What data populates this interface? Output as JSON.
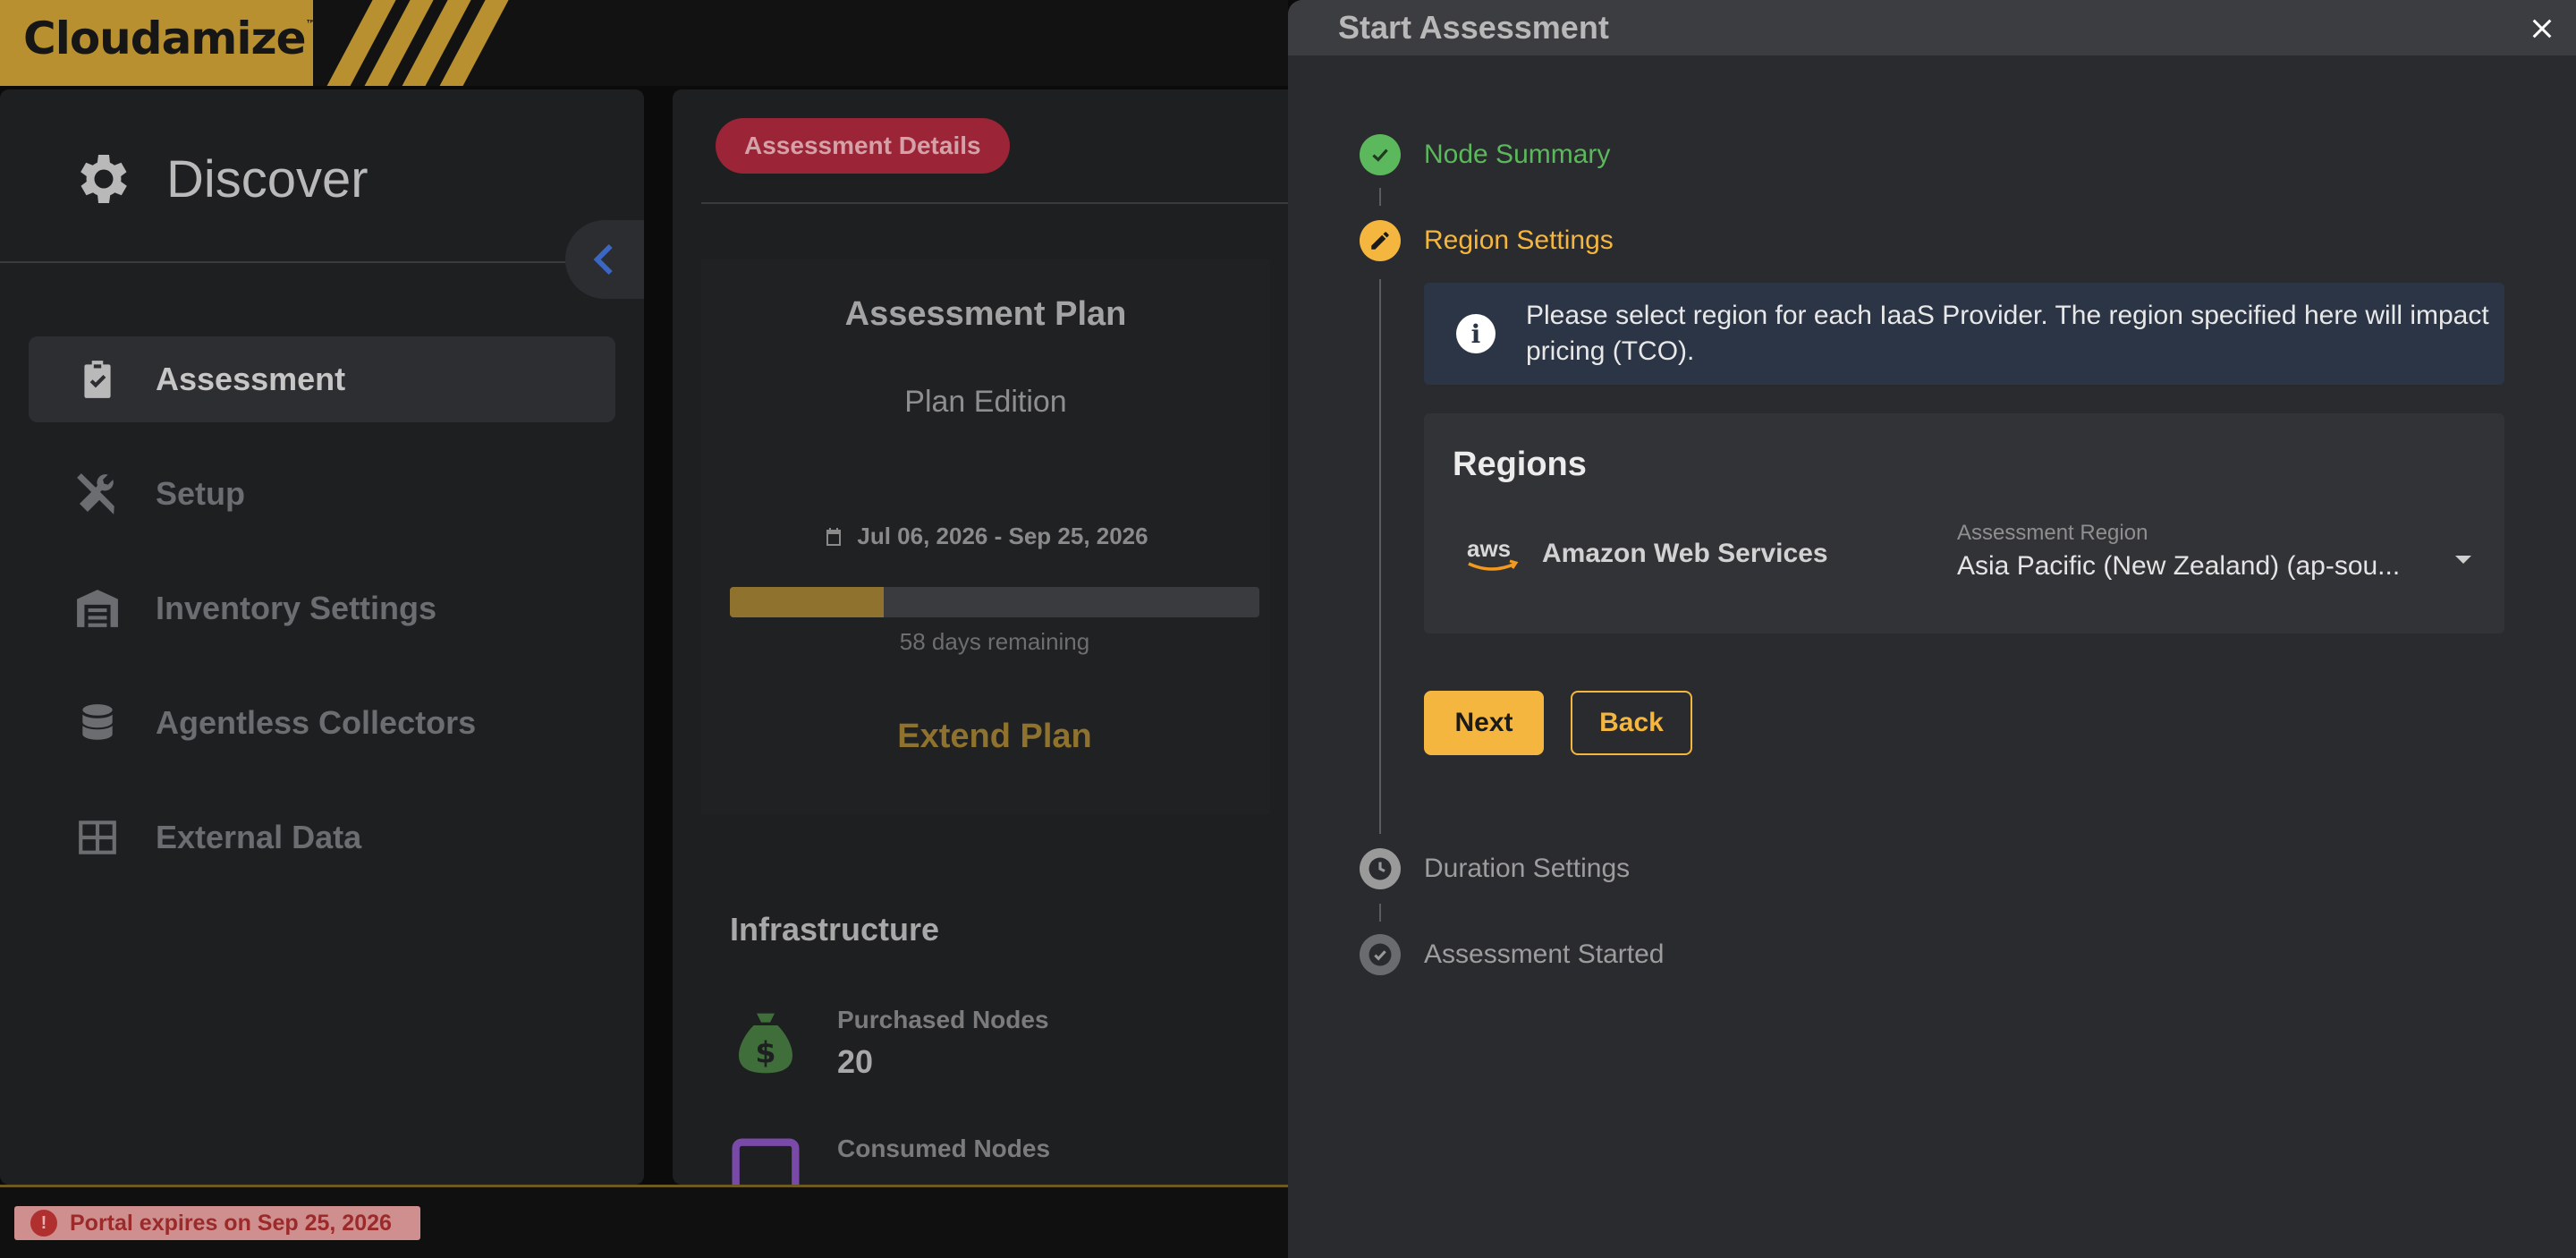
{
  "brand": {
    "name": "Cloudamize",
    "trademark": "™",
    "color": "#b8902f"
  },
  "sidebar": {
    "title": "Discover",
    "title_icon": "gear-icon",
    "collapse_icon": "chevron-left-icon",
    "items": [
      {
        "label": "Assessment",
        "icon": "clipboard-check-icon",
        "active": true
      },
      {
        "label": "Setup",
        "icon": "tools-icon",
        "active": false
      },
      {
        "label": "Inventory Settings",
        "icon": "warehouse-icon",
        "active": false
      },
      {
        "label": "Agentless Collectors",
        "icon": "database-icon",
        "active": false
      },
      {
        "label": "External Data",
        "icon": "table-icon",
        "active": false
      }
    ]
  },
  "main": {
    "tab_label": "Assessment Details",
    "plan": {
      "title": "Assessment Plan",
      "edition": "Plan Edition",
      "dates": "Jul 06, 2026 - Sep 25, 2026",
      "progress_percent": 29,
      "remaining": "58 days remaining",
      "extend_label": "Extend Plan"
    },
    "infrastructure": {
      "title": "Infrastructure",
      "purchased_label": "Purchased Nodes",
      "purchased_value": "20",
      "consumed_label": "Consumed Nodes"
    }
  },
  "footer": {
    "expiry": "Portal expires on Sep 25, 2026"
  },
  "drawer": {
    "title": "Start Assessment",
    "steps": [
      {
        "label": "Node Summary",
        "state": "done"
      },
      {
        "label": "Region Settings",
        "state": "active"
      },
      {
        "label": "Duration Settings",
        "state": "pending"
      },
      {
        "label": "Assessment Started",
        "state": "pending"
      }
    ],
    "info": "Please select region for each IaaS Provider. The region specified here will impact pricing (TCO).",
    "regions": {
      "title": "Regions",
      "provider_logo": "aws",
      "provider": "Amazon Web Services",
      "field_label": "Assessment Region",
      "field_value": "Asia Pacific (New Zealand) (ap-sou..."
    },
    "next_label": "Next",
    "back_label": "Back"
  },
  "colors": {
    "accent": "#f4b63f",
    "success": "#5cb85c",
    "danger_pill": "#9b2436",
    "info_bg": "#2b3545"
  }
}
